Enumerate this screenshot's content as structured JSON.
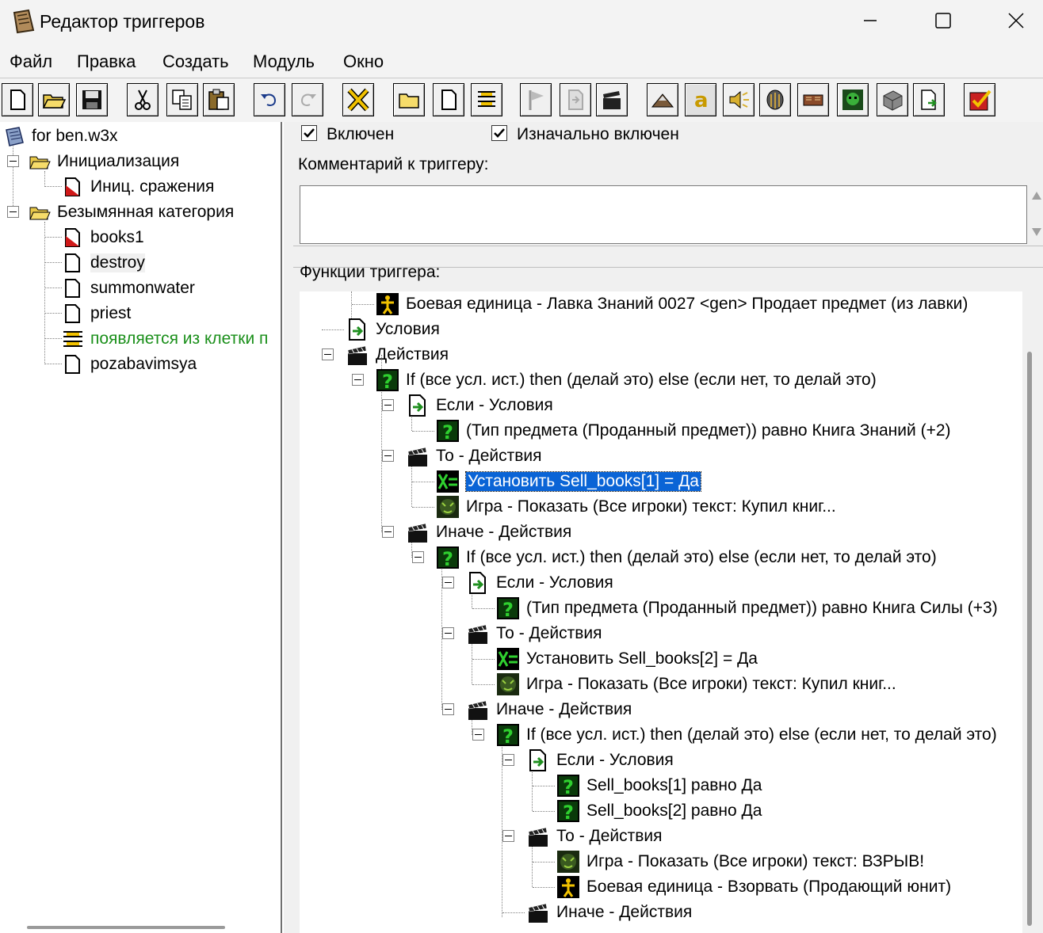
{
  "window": {
    "title": "Редактор триггеров"
  },
  "menu": [
    "Файл",
    "Правка",
    "Создать",
    "Модуль",
    "Окно"
  ],
  "toolbar": {
    "buttons": [
      "new-icon",
      "open-folder-icon",
      "save-icon",
      "cut-icon",
      "copy-icon",
      "paste-icon",
      "undo-icon",
      "redo-icon",
      "delete-x-icon",
      "new-category-icon",
      "new-trigger-icon",
      "new-comment-icon",
      "new-event-icon",
      "new-condition-icon",
      "new-action-icon",
      "terrain-editor-icon",
      "trigger-editor-icon",
      "sound-editor-icon",
      "object-editor-icon",
      "campaign-editor-icon",
      "ai-editor-icon",
      "import-manager-icon",
      "test-map-icon",
      "validate-icon"
    ]
  },
  "left_tree": {
    "root": "for ben.w3x",
    "categories": [
      {
        "label": "Инициализация",
        "items": [
          {
            "label": "Иниц. сражения",
            "icon": "map-init-icon"
          }
        ]
      },
      {
        "label": "Безымянная категория",
        "items": [
          {
            "label": "books1",
            "icon": "map-init-icon"
          },
          {
            "label": "destroy",
            "icon": "trigger-doc-icon"
          },
          {
            "label": "summonwater",
            "icon": "trigger-doc-icon"
          },
          {
            "label": "priest",
            "icon": "trigger-doc-icon"
          },
          {
            "label": "появляется из клетки п",
            "icon": "comment-lines-icon",
            "color": "#1a8f1a"
          },
          {
            "label": "pozabavimsya",
            "icon": "trigger-doc-icon"
          }
        ]
      }
    ]
  },
  "trigger_panel": {
    "enabled_label": "Включен",
    "enabled": true,
    "initially_on_label": "Изначально включен",
    "initially_on": true,
    "comment_label": "Комментарий к триггеру:",
    "comment_value": "",
    "functions_label": "Функции триггера:"
  },
  "functions": [
    {
      "text": "Боевая единица - Лавка Знаний 0027 <gen> Продает предмет (из лавки)",
      "icon": "unit-event-icon"
    },
    {
      "text": "Условия",
      "icon": "conditions-arrow-icon"
    },
    {
      "text": "Действия",
      "icon": "actions-clapper-icon"
    },
    {
      "text": "If (все усл. ист.) then (делай это) else (если нет, то делай это)",
      "icon": "question-icon"
    },
    {
      "text": "Если - Условия",
      "icon": "conditions-arrow-icon"
    },
    {
      "text": "(Тип предмета (Проданный предмет)) равно Книга Знаний (+2)",
      "icon": "question-icon"
    },
    {
      "text": "То - Действия",
      "icon": "actions-clapper-icon"
    },
    {
      "text": "Установить Sell_books[1] = Да",
      "icon": "set-variable-icon",
      "selected": true
    },
    {
      "text": "Игра - Показать (Все игроки) текст: Купил книг...",
      "icon": "game-text-icon"
    },
    {
      "text": "Иначе - Действия",
      "icon": "actions-clapper-icon"
    },
    {
      "text": "If (все усл. ист.) then (делай это) else (если нет, то делай это)",
      "icon": "question-icon"
    },
    {
      "text": "Если - Условия",
      "icon": "conditions-arrow-icon"
    },
    {
      "text": "(Тип предмета (Проданный предмет)) равно Книга Силы (+3)",
      "icon": "question-icon"
    },
    {
      "text": "То - Действия",
      "icon": "actions-clapper-icon"
    },
    {
      "text": "Установить Sell_books[2] = Да",
      "icon": "set-variable-icon"
    },
    {
      "text": "Игра - Показать (Все игроки) текст: Купил книг...",
      "icon": "game-text-icon"
    },
    {
      "text": "Иначе - Действия",
      "icon": "actions-clapper-icon"
    },
    {
      "text": "If (все усл. ист.) then (делай это) else (если нет, то делай это)",
      "icon": "question-icon"
    },
    {
      "text": "Если - Условия",
      "icon": "conditions-arrow-icon"
    },
    {
      "text": "Sell_books[1] равно Да",
      "icon": "question-icon"
    },
    {
      "text": "Sell_books[2] равно Да",
      "icon": "question-icon"
    },
    {
      "text": "То - Действия",
      "icon": "actions-clapper-icon"
    },
    {
      "text": "Игра - Показать (Все игроки) текст: ВЗРЫВ!",
      "icon": "game-text-icon"
    },
    {
      "text": "Боевая единица - Взорвать (Продающий юнит)",
      "icon": "unit-event-icon"
    },
    {
      "text": "Иначе - Действия",
      "icon": "actions-clapper-icon"
    }
  ],
  "colors": {
    "selection": "#0a64d6",
    "comment_text": "#1a8f1a",
    "icon_green": "#1f8f1f",
    "icon_yellow": "#f2c200"
  }
}
